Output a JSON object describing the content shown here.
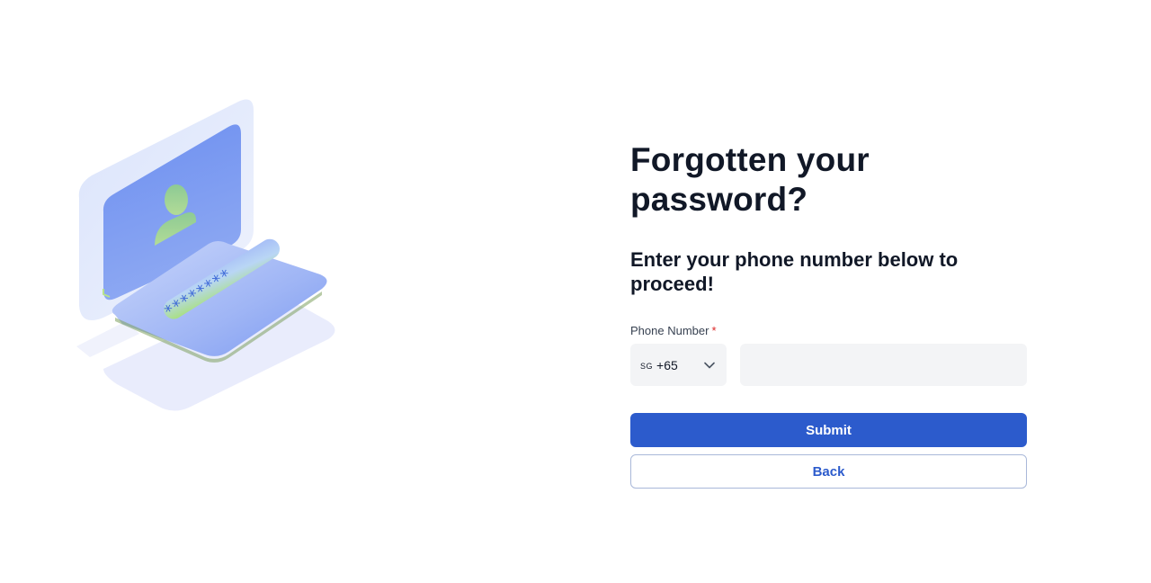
{
  "form": {
    "title_line1": "Forgotten your",
    "title_line2": "password?",
    "subtitle": "Enter your phone number below to proceed!",
    "phone_label": "Phone Number",
    "required_mark": "*",
    "country_code": "SG",
    "dial_code": "+65",
    "phone_value": "",
    "submit_label": "Submit",
    "back_label": "Back"
  },
  "illustration": {
    "password_mask": "********",
    "icon": "laptop-login-illustration"
  },
  "colors": {
    "primary": "#2c5bcc",
    "input_bg": "#f3f4f6",
    "text_dark": "#111827",
    "required": "#dc2626",
    "illustration_blue": "#6b8ef0",
    "illustration_green": "#a6e07a"
  }
}
